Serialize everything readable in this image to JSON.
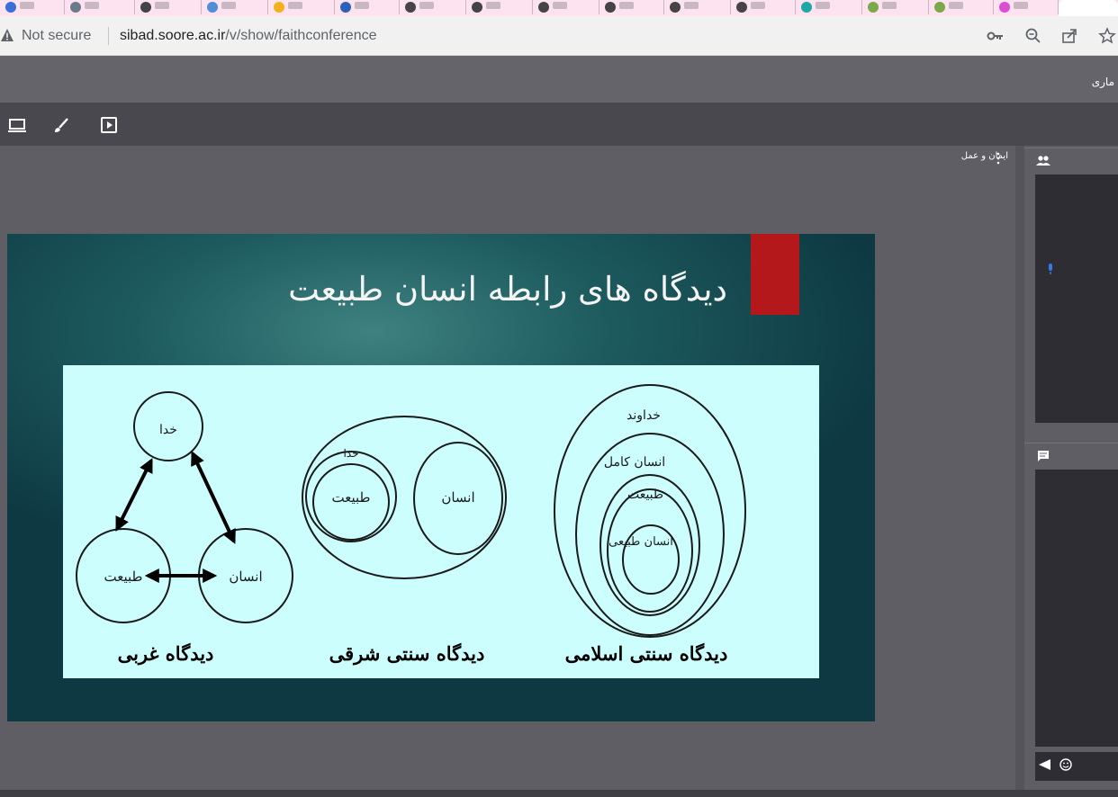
{
  "browser": {
    "security_label": "Not secure",
    "url_host": "sibad.soore.ac.ir",
    "url_path": "/v/show/faithconference",
    "icons": [
      "key-icon",
      "zoom-icon",
      "share-icon",
      "star-icon"
    ]
  },
  "app": {
    "header_title": "ماری",
    "toolbar_icons": [
      "screen-share-icon",
      "brush-icon",
      "presentation-icon"
    ],
    "pod_title": "ایمان و عمل"
  },
  "slide": {
    "title": "دیدگاه های رابطه انسان طبیعت",
    "colors": {
      "accent": "#b5181a",
      "figure_bg": "#ccfefe"
    },
    "diagrams": {
      "western": {
        "caption": "دیدگاه غربی",
        "god": "خدا",
        "nature": "طبیعت",
        "human": "انسان"
      },
      "eastern": {
        "caption": "دیدگاه سنتی شرقی",
        "god": "خدا",
        "nature": "طبیعت",
        "human": "انسان"
      },
      "islamic": {
        "caption": "دیدگاه سنتی اسلامی",
        "god": "خداوند",
        "perfect_human": "انسان کامل",
        "nature": "طبیعت",
        "natural_human": "انسان طبیعی"
      }
    }
  },
  "panels": {
    "users_icon": "users-icon",
    "chat_icon": "chat-icon"
  }
}
